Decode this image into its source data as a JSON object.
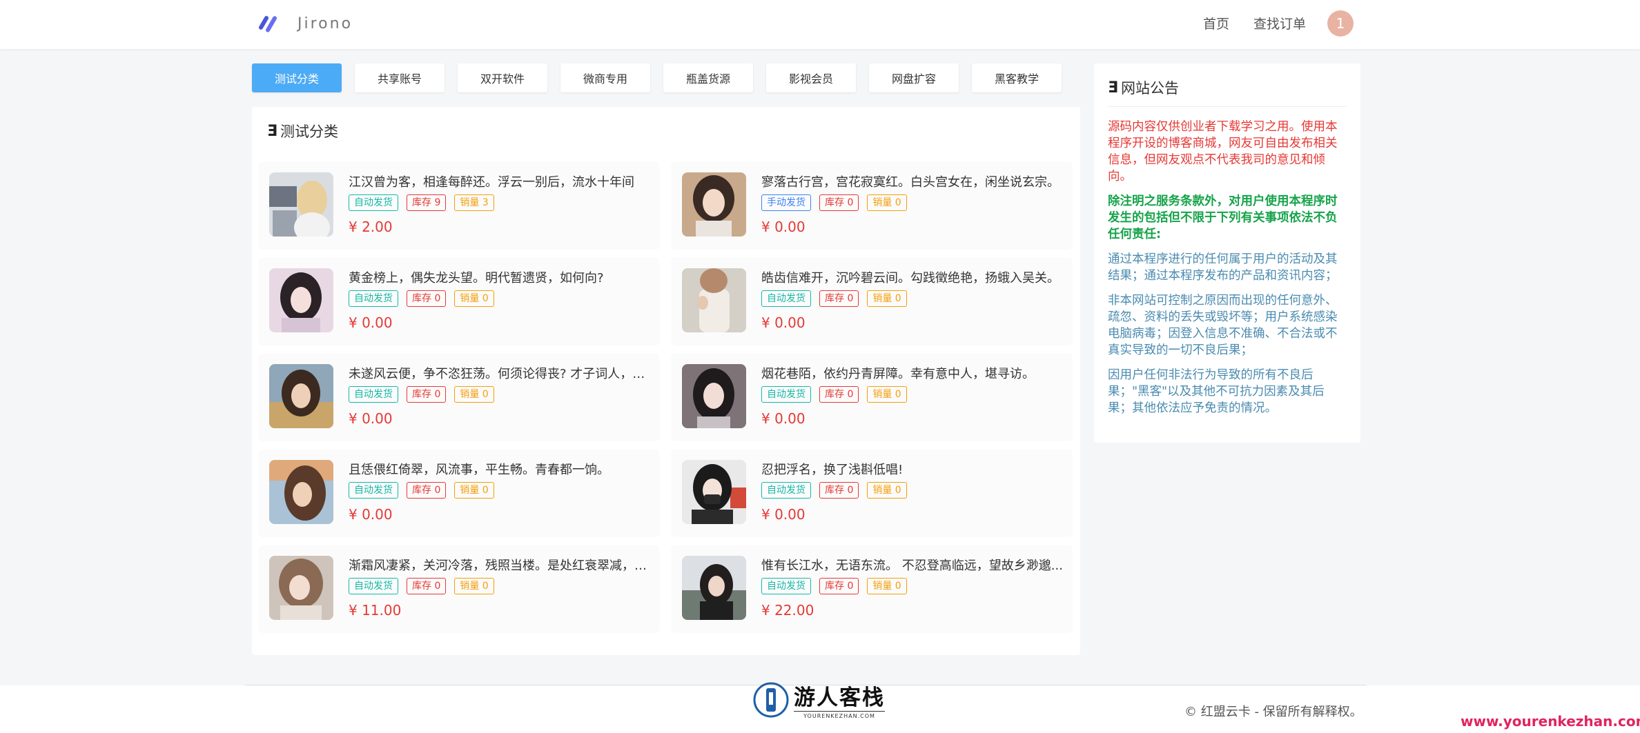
{
  "header": {
    "logo_text": "Jirono",
    "nav": [
      {
        "label": "首页"
      },
      {
        "label": "查找订单"
      }
    ],
    "avatar_text": "1"
  },
  "tabs": [
    {
      "label": "测试分类",
      "active": true
    },
    {
      "label": "共享账号"
    },
    {
      "label": "双开软件"
    },
    {
      "label": "微商专用"
    },
    {
      "label": "瓶盖货源"
    },
    {
      "label": "影视会员"
    },
    {
      "label": "网盘扩容"
    },
    {
      "label": "黑客教学"
    }
  ],
  "section": {
    "icon": "Ǝ",
    "title": "测试分类"
  },
  "products": [
    {
      "name": "江汉曾为客，相逢每醉还。浮云一别后，流水十年间",
      "delivery": "自动发货",
      "stock": "库存 9",
      "sales": "销量 3",
      "price": "¥ 2.00"
    },
    {
      "name": "寥落古行宫，宫花寂寞红。白头宫女在，闲坐说玄宗。",
      "delivery": "手动发货",
      "stock": "库存 0",
      "sales": "销量 0",
      "price": "¥ 0.00"
    },
    {
      "name": "黄金榜上，偶失龙头望。明代暂遗贤，如何向?",
      "delivery": "自动发货",
      "stock": "库存 0",
      "sales": "销量 0",
      "price": "¥ 0.00"
    },
    {
      "name": "皓齿信难开，沉吟碧云间。勾践徵绝艳，扬蛾入吴关。",
      "delivery": "自动发货",
      "stock": "库存 0",
      "sales": "销量 0",
      "price": "¥ 0.00"
    },
    {
      "name": "未遂风云便，争不恣狂荡。何须论得丧? 才子词人，自...",
      "delivery": "自动发货",
      "stock": "库存 0",
      "sales": "销量 0",
      "price": "¥ 0.00"
    },
    {
      "name": "烟花巷陌，依约丹青屏障。幸有意中人，堪寻访。",
      "delivery": "自动发货",
      "stock": "库存 0",
      "sales": "销量 0",
      "price": "¥ 0.00"
    },
    {
      "name": "且恁偎红倚翠，风流事，平生畅。青春都一饷。",
      "delivery": "自动发货",
      "stock": "库存 0",
      "sales": "销量 0",
      "price": "¥ 0.00"
    },
    {
      "name": "忍把浮名，换了浅斟低唱!",
      "delivery": "自动发货",
      "stock": "库存 0",
      "sales": "销量 0",
      "price": "¥ 0.00"
    },
    {
      "name": "渐霜风凄紧，关河冷落，残照当楼。是处红衰翠减，苒...",
      "delivery": "自动发货",
      "stock": "库存 0",
      "sales": "销量 0",
      "price": "¥ 11.00"
    },
    {
      "name": "惟有长江水，无语东流。 不忍登高临远，望故乡渺邈...",
      "delivery": "自动发货",
      "stock": "库存 0",
      "sales": "销量 0",
      "price": "¥ 22.00"
    }
  ],
  "notice": {
    "icon": "Ǝ",
    "title": "网站公告",
    "paragraphs": [
      "源码内容仅供创业者下载学习之用。使用本程序开设的博客商城，网友可自由发布相关信息，但网友观点不代表我司的意见和倾向。",
      "除注明之服务条款外，对用户使用本程序时发生的包括但不限于下列有关事项依法不负任何责任:",
      "通过本程序进行的任何属于用户的活动及其结果；通过本程序发布的产品和资讯内容；",
      "非本网站可控制之原因而出现的任何意外、疏忽、资料的丢失或毁坏等；用户系统感染电脑病毒；因登入信息不准确、不合法或不真实导致的一切不良后果；",
      "因用户任何非法行为导致的所有不良后果；\"黑客\"以及其他不可抗力因素及其后果；其他依法应予免责的情况。"
    ]
  },
  "footer": {
    "watermark_cn": "游人客栈",
    "watermark_en": "YOURENKEZHAN.COM",
    "copyright": "© 红盟云卡 - 保留所有解释权。",
    "site_url": "www.yourenkezhan.com"
  },
  "colors": {
    "accent": "#4cabf6",
    "price": "#e53935",
    "auto_badge": "#14b8a6",
    "manual_badge": "#3b82f6",
    "sales_badge": "#f59e0b",
    "notice_green": "#16a34a",
    "notice_blue": "#4a8bb0"
  }
}
